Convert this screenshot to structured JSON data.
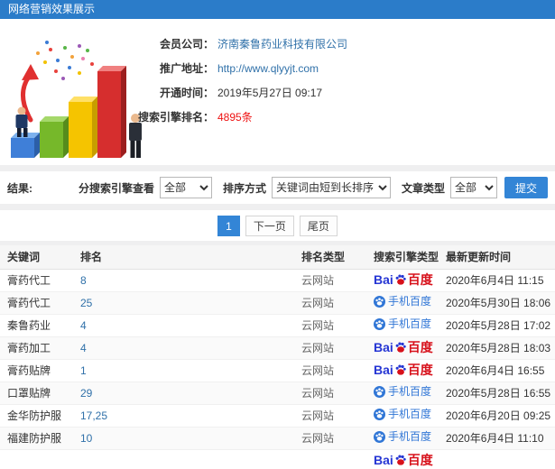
{
  "page": {
    "title": "网络营销效果展示"
  },
  "profile": {
    "fields": [
      {
        "label": "会员公司：",
        "value": "济南秦鲁药业科技有限公司"
      },
      {
        "label": "推广地址：",
        "value": "http://www.qlyyjt.com"
      },
      {
        "label": "开通时间：",
        "value": "2019年5月27日 09:17"
      },
      {
        "label": "搜索引擎排名：",
        "value": "4895条"
      }
    ]
  },
  "filters": {
    "result_label": "结果:",
    "engine_label": "分搜索引擎查看",
    "engine_value": "全部",
    "sort_label": "排序方式",
    "sort_value": "关键词由短到长排序",
    "article_label": "文章类型",
    "article_value": "全部",
    "submit_label": "提交"
  },
  "pagination": {
    "current": "1",
    "next": "下一页",
    "last": "尾页"
  },
  "engines": {
    "baidu": {
      "prefix": "Bai",
      "suffix": "百度"
    },
    "mobile": {
      "label": "手机百度"
    }
  },
  "table": {
    "columns": [
      "关键词",
      "排名",
      "排名类型",
      "搜索引擎类型",
      "最新更新时间"
    ],
    "rows": [
      {
        "keyword": "膏药代工",
        "rank": "8",
        "rank_type": "云网站",
        "engine": "baidu",
        "time": "2020年6月4日 11:15"
      },
      {
        "keyword": "膏药代工",
        "rank": "25",
        "rank_type": "云网站",
        "engine": "mobile",
        "time": "2020年5月30日 18:06"
      },
      {
        "keyword": "秦鲁药业",
        "rank": "4",
        "rank_type": "云网站",
        "engine": "mobile",
        "time": "2020年5月28日 17:02"
      },
      {
        "keyword": "膏药加工",
        "rank": "4",
        "rank_type": "云网站",
        "engine": "baidu",
        "time": "2020年5月28日 18:03"
      },
      {
        "keyword": "膏药贴牌",
        "rank": "1",
        "rank_type": "云网站",
        "engine": "baidu",
        "time": "2020年6月4日 16:55"
      },
      {
        "keyword": "口罩贴牌",
        "rank": "29",
        "rank_type": "云网站",
        "engine": "mobile",
        "time": "2020年5月28日 16:55"
      },
      {
        "keyword": "金华防护服",
        "rank": "17,25",
        "rank_type": "云网站",
        "engine": "mobile",
        "time": "2020年6月20日 09:25"
      },
      {
        "keyword": "福建防护服",
        "rank": "10",
        "rank_type": "云网站",
        "engine": "mobile",
        "time": "2020年6月4日 11:10"
      },
      {
        "keyword": "",
        "rank": "",
        "rank_type": "",
        "engine": "baidu",
        "time": ""
      }
    ]
  },
  "colors": {
    "header_blue": "#2b7cc9",
    "link_blue": "#3071a9",
    "highlight_red": "#ee1111",
    "accent_blue": "#3385d6",
    "baidu_blue": "#2636d4",
    "baidu_red": "#d7111b",
    "mobile_blue": "#3076d6"
  }
}
